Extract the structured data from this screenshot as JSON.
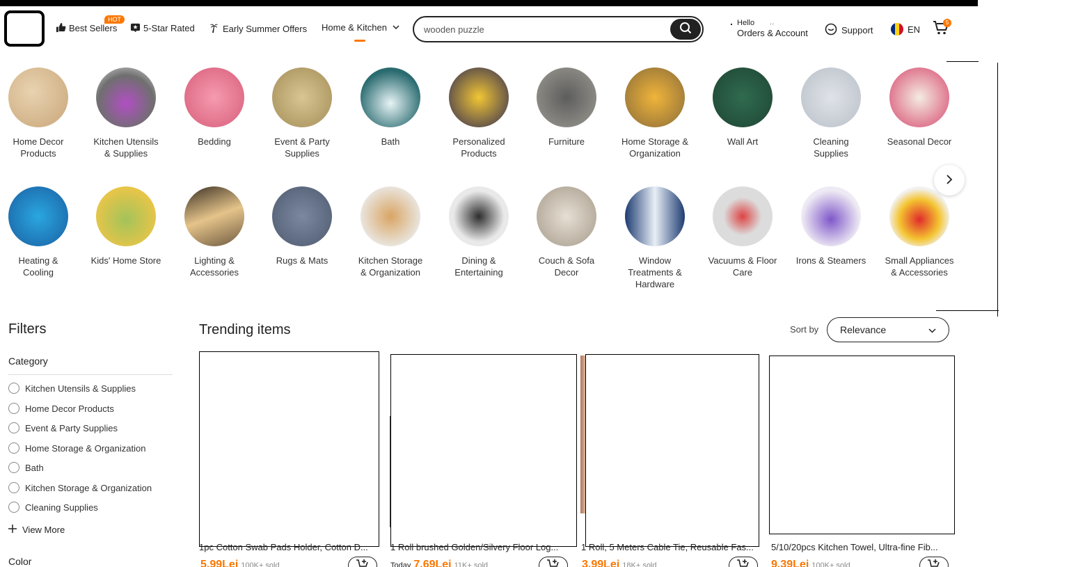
{
  "header": {
    "nav": {
      "best_sellers": "Best Sellers",
      "hot_badge": "HOT",
      "five_star": "5-Star Rated",
      "early_summer": "Early Summer Offers",
      "home_kitchen": "Home & Kitchen"
    },
    "search": {
      "value": "wooden puzzle"
    },
    "account": {
      "hello": "Hello",
      "orders": "Orders & Account"
    },
    "support": "Support",
    "language": "EN",
    "cart_count": "5"
  },
  "categories": [
    {
      "label": "Home Decor Products"
    },
    {
      "label": "Kitchen Utensils & Supplies"
    },
    {
      "label": "Bedding"
    },
    {
      "label": "Event & Party Supplies"
    },
    {
      "label": "Bath"
    },
    {
      "label": "Personalized Products"
    },
    {
      "label": "Furniture"
    },
    {
      "label": "Home Storage & Organization"
    },
    {
      "label": "Wall Art"
    },
    {
      "label": "Cleaning Supplies"
    },
    {
      "label": "Seasonal Decor"
    },
    {
      "label": "Heating & Cooling"
    },
    {
      "label": "Kids' Home Store"
    },
    {
      "label": "Lighting & Accessories"
    },
    {
      "label": "Rugs & Mats"
    },
    {
      "label": "Kitchen Storage & Organization"
    },
    {
      "label": "Dining & Entertaining"
    },
    {
      "label": "Couch & Sofa Decor"
    },
    {
      "label": "Window Treatments & Hardware"
    },
    {
      "label": "Vacuums & Floor Care"
    },
    {
      "label": "Irons & Steamers"
    },
    {
      "label": "Small Appliances & Accessories"
    }
  ],
  "filters": {
    "title": "Filters",
    "category_title": "Category",
    "items": [
      "Kitchen Utensils & Supplies",
      "Home Decor Products",
      "Event & Party Supplies",
      "Home Storage & Organization",
      "Bath",
      "Kitchen Storage & Organization",
      "Cleaning Supplies"
    ],
    "view_more": "View More",
    "color_title": "Color"
  },
  "trending": {
    "title": "Trending items",
    "sort_label": "Sort by",
    "sort_value": "Relevance",
    "products": [
      {
        "title": "1pc Cotton Swab Pads Holder, Cotton D...",
        "today": "",
        "price": "5.99Lei",
        "sold": "100K+ sold"
      },
      {
        "title": "1 Roll brushed Golden/Silvery Floor Log...",
        "today": "Today",
        "price": "7.69Lei",
        "sold": "11K+ sold"
      },
      {
        "title": "1 Roll, 5 Meters Cable Tie, Reusable Fas...",
        "today": "",
        "price": "3.99Lei",
        "sold": "18K+ sold"
      },
      {
        "title": "5/10/20pcs Kitchen Towel, Ultra-fine Fib...",
        "today": "",
        "price": "9.39Lei",
        "sold": "100K+ sold"
      }
    ]
  },
  "colors": {
    "accent": "#fb7701",
    "text": "#222222"
  }
}
